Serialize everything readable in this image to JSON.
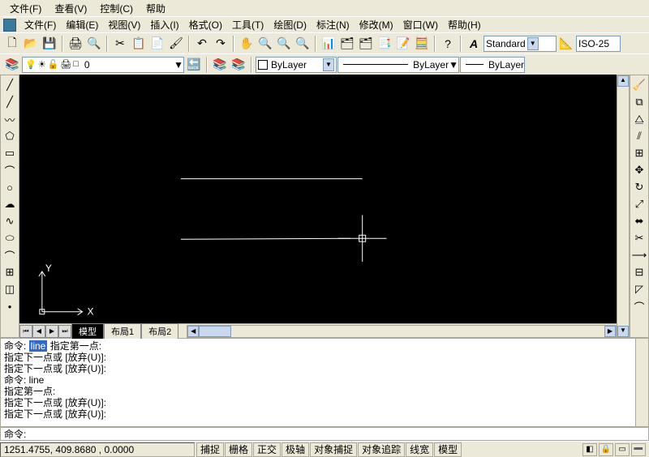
{
  "menu1": {
    "file": "文件(F)",
    "view": "查看(V)",
    "control": "控制(C)",
    "help": "帮助"
  },
  "menu2": {
    "file": "文件(F)",
    "edit": "编辑(E)",
    "view": "视图(V)",
    "insert": "插入(I)",
    "format": "格式(O)",
    "tools": "工具(T)",
    "draw": "绘图(D)",
    "dimension": "标注(N)",
    "modify": "修改(M)",
    "window": "窗口(W)",
    "help": "帮助(H)"
  },
  "layer": {
    "name": "0",
    "color": "□"
  },
  "properties": {
    "color_label": "ByLayer",
    "linetype_label": "ByLayer",
    "lineweight_label": "ByLayer"
  },
  "text_style": "Standard",
  "dim_style": "ISO-25",
  "tabs": {
    "model": "模型",
    "layout1": "布局1",
    "layout2": "布局2"
  },
  "cmdhist": [
    {
      "prefix": "命令: ",
      "hl": "line",
      "suffix": " 指定第一点:"
    },
    {
      "text": "指定下一点或 [放弃(U)]:"
    },
    {
      "text": "指定下一点或 [放弃(U)]:"
    },
    {
      "text": "命令:  line"
    },
    {
      "text": "指定第一点:"
    },
    {
      "text": "指定下一点或 [放弃(U)]:"
    },
    {
      "text": "指定下一点或 [放弃(U)]:"
    }
  ],
  "cmd_prompt": "命令:",
  "status": {
    "coords": "1251.4755, 409.8680 , 0.0000",
    "snap": "捕捉",
    "grid": "栅格",
    "ortho": "正交",
    "polar": "极轴",
    "osnap": "对象捕捉",
    "otrack": "对象追踪",
    "lwt": "线宽",
    "model": "模型"
  },
  "axis": {
    "x": "X",
    "y": "Y"
  }
}
